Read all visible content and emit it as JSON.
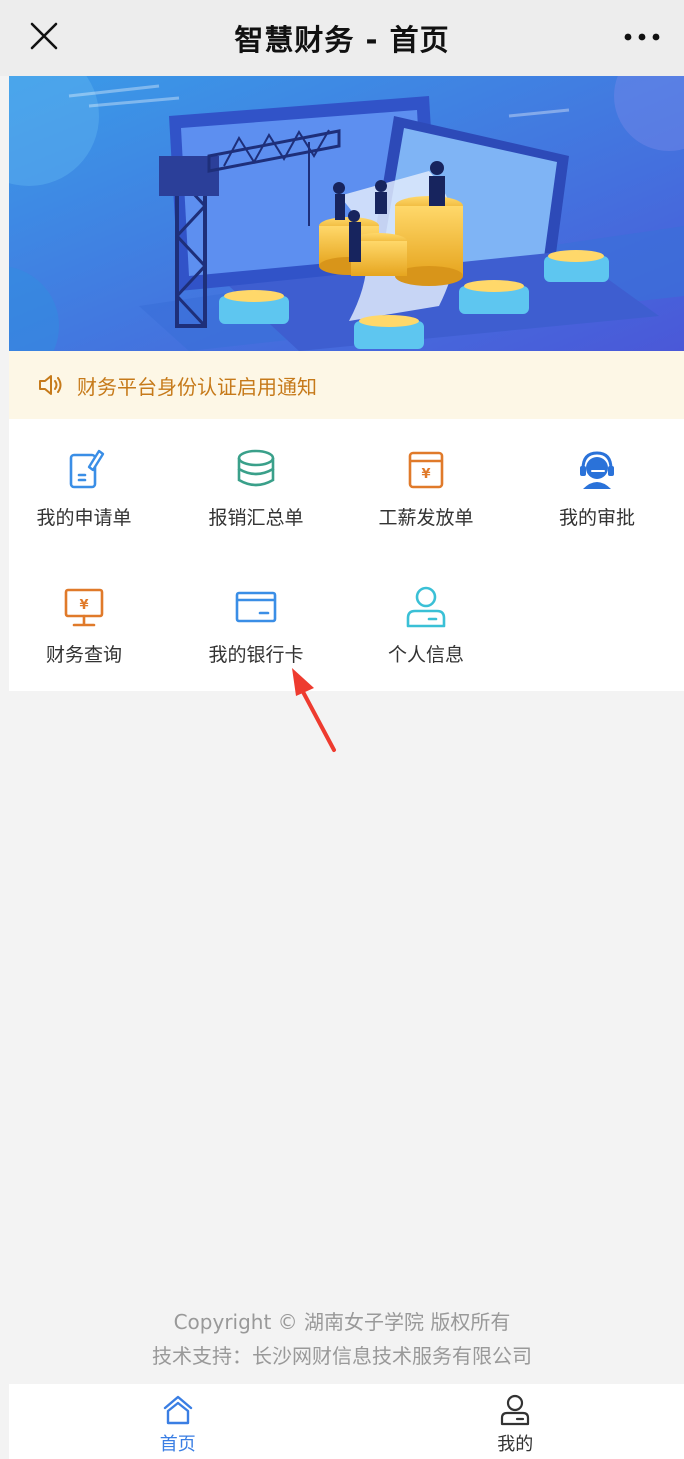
{
  "titlebar": {
    "title": "智慧财务 - 首页",
    "close_icon": "close-icon",
    "more_icon": "more-icon"
  },
  "notice": {
    "icon": "speaker-icon",
    "text": "财务平台身份认证启用通知",
    "color": "#c67a1a"
  },
  "menu": {
    "items": [
      {
        "label": "我的申请单",
        "icon": "form-edit-icon",
        "color": "#3a8ee6"
      },
      {
        "label": "报销汇总单",
        "icon": "coin-stack-icon",
        "color": "#3aa08a"
      },
      {
        "label": "工薪发放单",
        "icon": "salary-box-icon",
        "color": "#e07a2a"
      },
      {
        "label": "我的审批",
        "icon": "headset-icon",
        "color": "#2a72d9"
      },
      {
        "label": "财务查询",
        "icon": "monitor-yen-icon",
        "color": "#e07a2a"
      },
      {
        "label": "我的银行卡",
        "icon": "bank-card-icon",
        "color": "#3a8ee6"
      },
      {
        "label": "个人信息",
        "icon": "user-icon",
        "color": "#3ac0d6"
      }
    ]
  },
  "footer": {
    "copyright": "Copyright © 湖南女子学院 版权所有",
    "support": "技术支持：长沙网财信息技术服务有限公司"
  },
  "tabbar": {
    "tabs": [
      {
        "label": "首页",
        "icon": "home-icon",
        "active": true
      },
      {
        "label": "我的",
        "icon": "profile-icon",
        "active": false
      }
    ],
    "active_color": "#3a7ee3"
  }
}
